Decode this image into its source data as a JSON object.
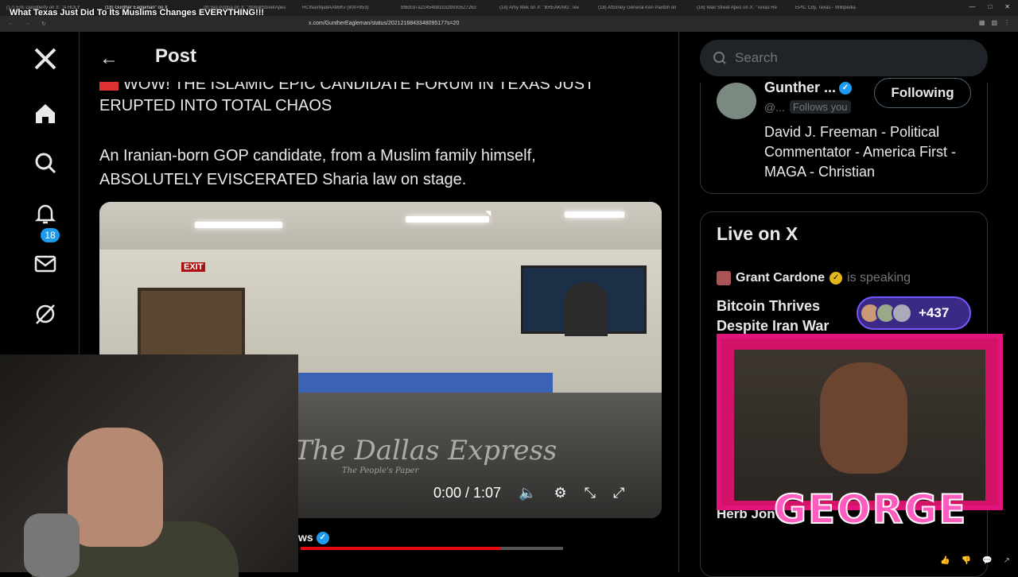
{
  "browser": {
    "tabs": [
      "(17) Eric Daugherty on X: \"A HOLY",
      "(18) Gunther Eagleman\" on X",
      "(8) Big Poppa on X: \"@WallStreetApes",
      "HCWaxNja8AAb6Kv (800×853)",
      "bf8dcd7a22454b81b32b930527263",
      "(18) Amy Mek on X: \"BREAKING: Tex",
      "(18) Attorney General Ken Paxton on",
      "(16) Wall Street Apes on X: \"Texas Re",
      "EPIC City, Texas - Wikipedia"
    ],
    "active_tab_index": 1,
    "url": "x.com/GuntherEagleman/status/2021216843348095177s=20"
  },
  "video_overlay_title": "What Texas Just Did To Its Muslims Changes EVERYTHING!!!",
  "nav": {
    "notification_count": "18"
  },
  "post": {
    "header_title": "Post",
    "line1": "WOW! THE ISLAMIC EPIC CANDIDATE FORUM IN TEXAS JUST",
    "line2": "ERUPTED INTO TOTAL CHAOS",
    "paragraph": "An Iranian-born GOP candidate, from a Muslim family himself, ABSOLUTELY EVISCERATED Sharia law on stage.",
    "video": {
      "watermark": "The Dallas Express",
      "watermark_sub": "The People's Paper",
      "exit_sign": "EXIT",
      "time": "0:00 / 1:07",
      "progress_fraction": 0.0
    },
    "below_author_partial": "ws"
  },
  "sidebar": {
    "search_placeholder": "Search",
    "who_card": {
      "name": "Gunther ...",
      "handle": "@...",
      "follows_you": "Follows you",
      "follow_button": "Following",
      "bio": "David J. Freeman - Political Commentator - America First - MAGA - Christian"
    },
    "live": {
      "title": "Live on X",
      "host": "Grant Cardone",
      "status": "is speaking",
      "space_title": "Bitcoin Thrives Despite Iran War",
      "listener_count": "+437",
      "next_partial": "Herb Jon"
    }
  },
  "streamer_overlay": {
    "name": "GEORGE"
  },
  "stream_progress_fraction": 0.76,
  "colors": {
    "accent": "#1d9bf0",
    "live_border": "#7856ff",
    "george_frame": "#e0147a"
  }
}
